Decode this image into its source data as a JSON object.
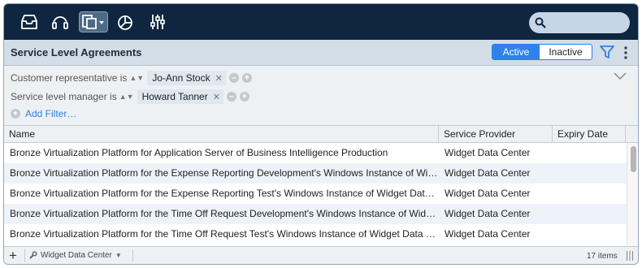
{
  "toolbar": {
    "buttons": [
      {
        "name": "inbox-icon"
      },
      {
        "name": "headset-icon"
      },
      {
        "name": "documents-icon",
        "selected": true
      },
      {
        "name": "pie-chart-icon"
      },
      {
        "name": "sliders-icon"
      }
    ],
    "search": {
      "placeholder": "",
      "icon": "search-icon"
    }
  },
  "titlebar": {
    "title": "Service Level Agreements",
    "segments": {
      "active": "Active",
      "inactive": "Inactive",
      "selected": "Active"
    },
    "filter_icon": "funnel-icon",
    "more_icon": "vertical-ellipsis-icon"
  },
  "filters": {
    "rows": [
      {
        "field": "Customer representative is",
        "value": "Jo-Ann Stock"
      },
      {
        "field": "Service level manager is",
        "value": "Howard Tanner"
      }
    ],
    "add_filter": "Add Filter…"
  },
  "table": {
    "columns": [
      "Name",
      "Service Provider",
      "Expiry Date"
    ],
    "rows": [
      {
        "name": "Bronze Virtualization Platform for Application Server of Business Intelligence Production",
        "provider": "Widget Data Center",
        "expiry": ""
      },
      {
        "name": "Bronze Virtualization Platform for the Expense Reporting Development's Windows Instance of Widget Data Center",
        "provider": "Widget Data Center",
        "expiry": ""
      },
      {
        "name": "Bronze Virtualization Platform for the Expense Reporting Test's Windows Instance of Widget Data Center",
        "provider": "Widget Data Center",
        "expiry": ""
      },
      {
        "name": "Bronze Virtualization Platform for the Time Off Request Development's Windows Instance of Widget Data Center",
        "provider": "Widget Data Center",
        "expiry": ""
      },
      {
        "name": "Bronze Virtualization Platform for the Time Off Request Test's Windows Instance of Widget Data Center",
        "provider": "Widget Data Center",
        "expiry": ""
      }
    ]
  },
  "footer": {
    "add": "+",
    "scope": "Widget Data Center",
    "count": "17 items"
  },
  "colors": {
    "toolbar": "#0e2640",
    "accent": "#2f82ea",
    "titlebar": "#d3dde7"
  }
}
